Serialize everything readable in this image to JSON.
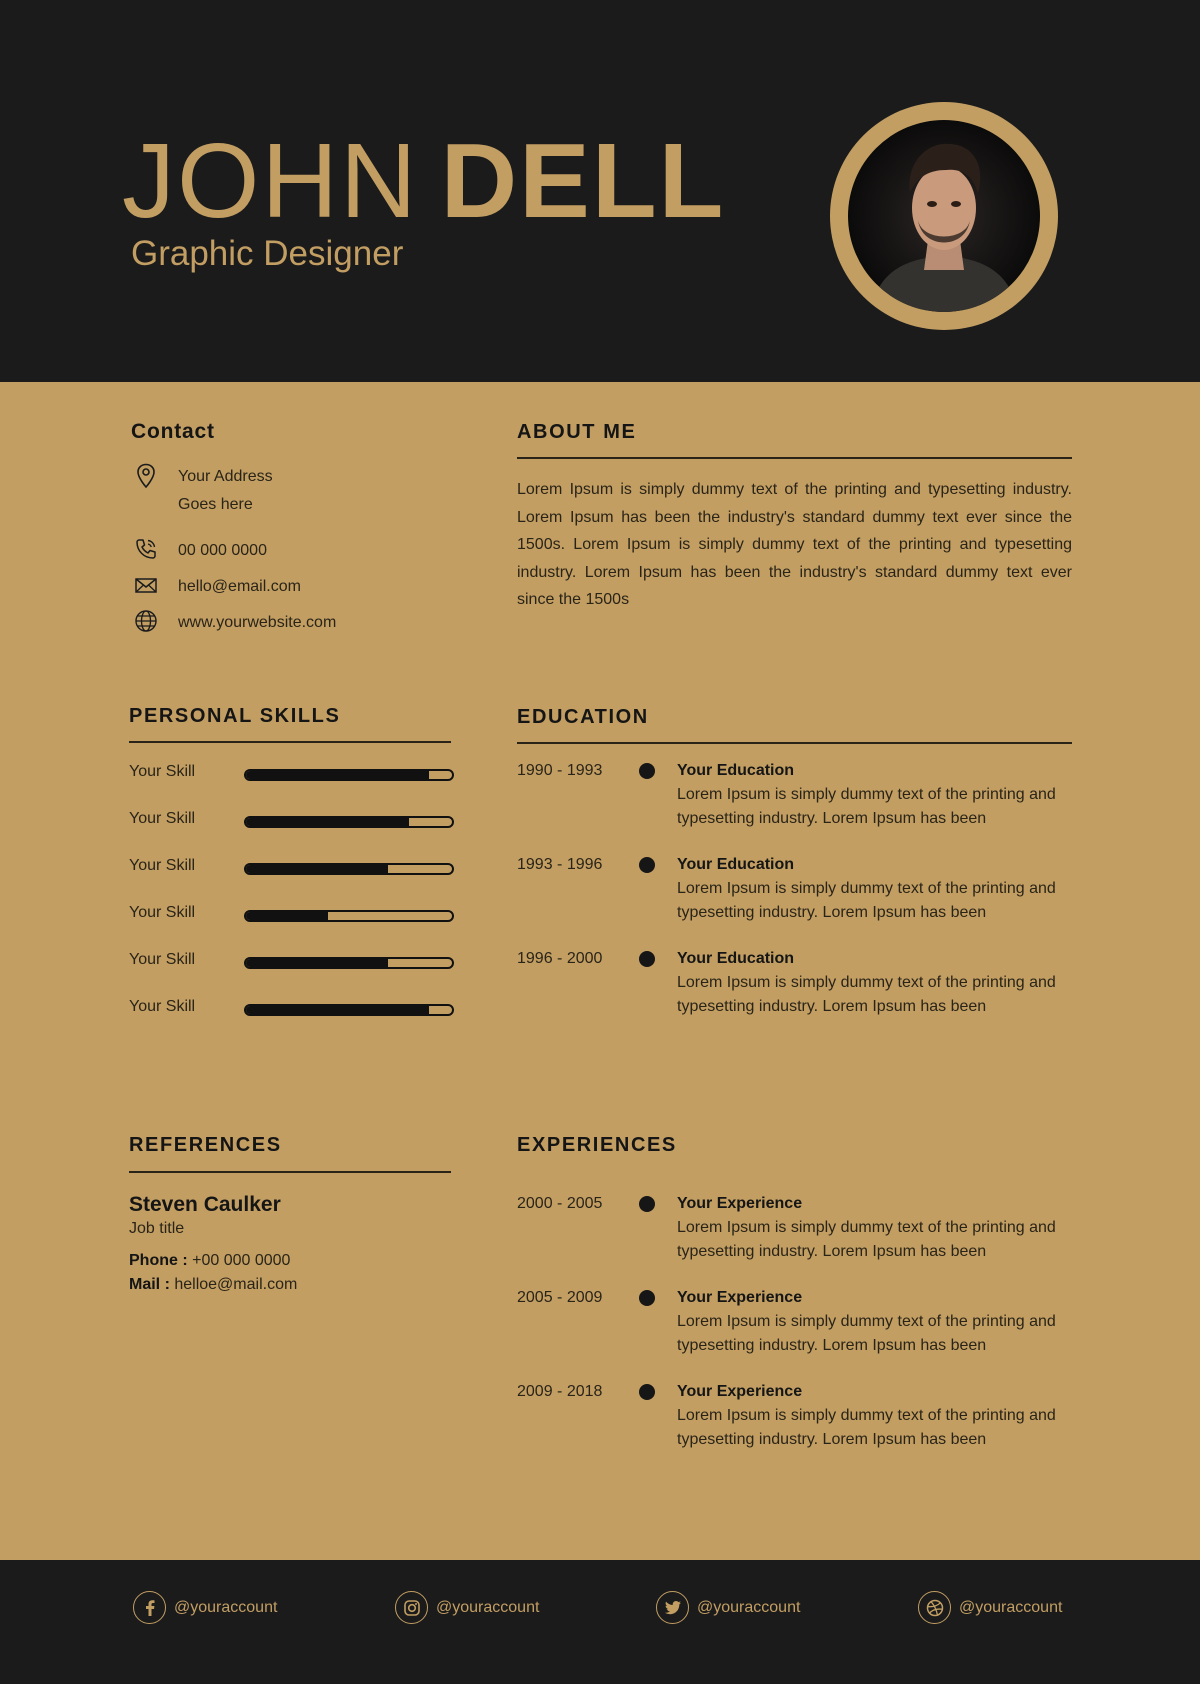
{
  "colors": {
    "accent": "#c29e62",
    "dark": "#1b1b1c",
    "text": "#2a2418"
  },
  "header": {
    "first_name": "JOHN",
    "last_name": "DELL",
    "role": "Graphic Designer",
    "photo_icon": "portrait-photo"
  },
  "contact": {
    "title": "Contact",
    "address_line1": "Your Address",
    "address_line2": "Goes here",
    "phone": "00 000 0000",
    "email": "hello@email.com",
    "website": "www.yourwebsite.com",
    "icons": [
      "map-pin-icon",
      "phone-icon",
      "envelope-icon",
      "globe-icon"
    ]
  },
  "about": {
    "title": "ABOUT ME",
    "text": "Lorem Ipsum is simply dummy text of the printing and typesetting industry. Lorem Ipsum has been the industry's standard dummy text ever since the 1500s. Lorem Ipsum is simply dummy text of the printing and typesetting industry. Lorem Ipsum has been the industry's standard dummy text ever since the 1500s"
  },
  "skills": {
    "title": "PERSONAL SKILLS",
    "items": [
      {
        "label": "Your Skill",
        "level": 0.89
      },
      {
        "label": "Your Skill",
        "level": 0.79
      },
      {
        "label": "Your Skill",
        "level": 0.69
      },
      {
        "label": "Your Skill",
        "level": 0.4
      },
      {
        "label": "Your Skill",
        "level": 0.69
      },
      {
        "label": "Your Skill",
        "level": 0.89
      }
    ]
  },
  "education": {
    "title": "EDUCATION",
    "items": [
      {
        "years": "1990 - 1993",
        "title": "Your Education",
        "desc": "Lorem Ipsum is simply dummy text of the printing and typesetting industry. Lorem Ipsum has been"
      },
      {
        "years": "1993 - 1996",
        "title": "Your Education",
        "desc": "Lorem Ipsum is simply dummy text of the printing and typesetting industry. Lorem Ipsum has been"
      },
      {
        "years": "1996 - 2000",
        "title": "Your Education",
        "desc": "Lorem Ipsum is simply dummy text of the printing and typesetting industry. Lorem Ipsum has been"
      }
    ]
  },
  "references": {
    "title": "REFERENCES",
    "name": "Steven Caulker",
    "job": "Job title",
    "phone_label": "Phone :",
    "phone": "+00 000 0000",
    "mail_label": "Mail :",
    "mail": "helloe@mail.com"
  },
  "experiences": {
    "title": "EXPERIENCES",
    "items": [
      {
        "years": "2000 - 2005",
        "title": "Your Experience",
        "desc": "Lorem Ipsum is simply dummy text of the printing and typesetting industry. Lorem Ipsum has been"
      },
      {
        "years": "2005 - 2009",
        "title": "Your Experience",
        "desc": "Lorem Ipsum is simply dummy text of the printing and typesetting industry. Lorem Ipsum has been"
      },
      {
        "years": "2009 - 2018",
        "title": "Your Experience",
        "desc": "Lorem Ipsum is simply dummy text of the printing and typesetting industry. Lorem Ipsum has been"
      }
    ]
  },
  "footer": {
    "socials": [
      {
        "icon": "facebook-icon",
        "handle": "@youraccount"
      },
      {
        "icon": "instagram-icon",
        "handle": "@youraccount"
      },
      {
        "icon": "twitter-icon",
        "handle": "@youraccount"
      },
      {
        "icon": "dribbble-icon",
        "handle": "@youraccount"
      }
    ]
  }
}
